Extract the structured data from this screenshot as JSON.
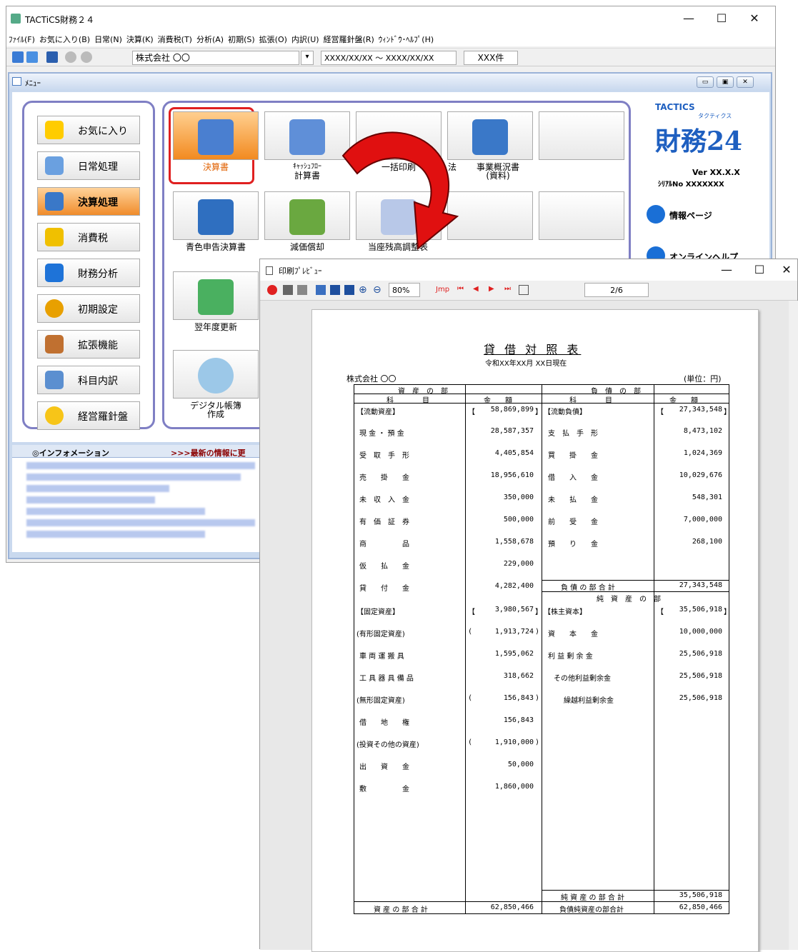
{
  "window": {
    "title": "TACTiCS財務２４",
    "minimize": "—",
    "maximize": "☐",
    "close": "✕"
  },
  "menubar": [
    "ﾌｧｲﾙ(F)",
    "お気に入り(B)",
    "日常(N)",
    "決算(K)",
    "消費税(T)",
    "分析(A)",
    "初期(S)",
    "拡張(O)",
    "内訳(U)",
    "経営羅針盤(R)",
    "ｳｨﾝﾄﾞｳ･ﾍﾙﾌﾟ(H)"
  ],
  "toolbar": {
    "company": "株式会社 〇〇",
    "period": "XXXX/XX/XX ～ XXXX/XX/XX",
    "count": "XXX件",
    "dropdown": "▾"
  },
  "menu_window": {
    "title": "ﾒﾆｭｰ",
    "btns": [
      "▭",
      "▣",
      "✕"
    ]
  },
  "nav": [
    "お気に入り",
    "日常処理",
    "決算処理",
    "消費税",
    "財務分析",
    "初期設定",
    "拡張機能",
    "科目内訳",
    "経営羅針盤"
  ],
  "tiles": {
    "kessansho": "決算書",
    "cashflow": [
      "ｷｬｯｼｭﾌﾛｰ",
      "計算書"
    ],
    "ikkatsu": "一括印刷",
    "jigyo": [
      "事業概況書",
      "(資料)"
    ],
    "aoiro": "青色申告決算書",
    "genka": "減価償却",
    "touza": "当座残高調整表",
    "yokunen": "翌年度更新",
    "digital": [
      "デジタル帳簿",
      "作成"
    ],
    "cut1": "法"
  },
  "brand": {
    "logo": "TACTICS",
    "logo_sub": "タクティクス",
    "name": "財務24",
    "ver": "Ver XX.X.X",
    "serial": "ｼﾘｱﾙNo XXXXXXX",
    "info_page": "情報ページ",
    "online": "オンラインヘルプ"
  },
  "info": {
    "title": "◎インフォメーション",
    "link": ">>>最新の情報に更"
  },
  "preview": {
    "title": "印刷ﾌﾟﾚﾋﾞｭｰ",
    "zoom": "80%",
    "jmp": "Jmp",
    "page": "2/6"
  },
  "bs": {
    "title": "貸 借 対 照 表",
    "date": "令和XX年XX月 XX日現在",
    "company": "株式会社 〇〇",
    "unit": "(単位：円)",
    "asset_head": "資　産　の　部",
    "liab_head": "負　債　の　部",
    "col_item": "科　　　　目",
    "col_amt": "金　　額",
    "current_assets": "【流動資産】",
    "current_assets_amt": "58,869,899",
    "fixed_assets": "【固定資産】",
    "fixed_assets_amt": "3,980,567",
    "current_liab": "【流動負債】",
    "current_liab_amt": "27,343,548",
    "equity_head": "純　資　産　の　部",
    "shareholder": "【株主資本】",
    "shareholder_amt": "35,506,918",
    "assets_rows": [
      [
        "現 金 ・ 預 金",
        "28,587,357"
      ],
      [
        "受　取　手　形",
        "4,405,854"
      ],
      [
        "売　　掛　　金",
        "18,956,610"
      ],
      [
        "未　収　入　金",
        "350,000"
      ],
      [
        "有　価　証　券",
        "500,000"
      ],
      [
        "商　　　　　品",
        "1,558,678"
      ],
      [
        "仮　　払　　金",
        "229,000"
      ],
      [
        "貸　　付　　金",
        "4,282,400"
      ]
    ],
    "fixed_rows": [
      [
        "(有形固定資産)",
        "1,913,724",
        true
      ],
      [
        "車 両 運 搬 具",
        "1,595,062",
        false
      ],
      [
        "工 具 器 具 備 品",
        "318,662",
        false
      ],
      [
        "(無形固定資産)",
        "156,843",
        true
      ],
      [
        "借　　地　　権",
        "156,843",
        false
      ],
      [
        "(投資その他の資産)",
        "1,910,000",
        true
      ],
      [
        "出　　資　　金",
        "50,000",
        false
      ],
      [
        "敷　　　　　金",
        "1,860,000",
        false
      ]
    ],
    "liab_rows": [
      [
        "支　払　手　形",
        "8,473,102"
      ],
      [
        "買　　掛　　金",
        "1,024,369"
      ],
      [
        "借　　入　　金",
        "10,029,676"
      ],
      [
        "未　　払　　金",
        "548,301"
      ],
      [
        "前　　受　　金",
        "7,000,000"
      ],
      [
        "預　　り　　金",
        "268,100"
      ]
    ],
    "liab_total": [
      "負 債 の 部 合 計",
      "27,343,548"
    ],
    "equity_rows": [
      [
        "資　　本　　金",
        "10,000,000"
      ],
      [
        "利 益 剰 余 金",
        "25,506,918"
      ],
      [
        "その他利益剰余金",
        "25,506,918"
      ],
      [
        "繰越利益剰余金",
        "25,506,918"
      ]
    ],
    "net_total": [
      "純 資 産 の 部 合 計",
      "35,506,918"
    ],
    "asset_total": [
      "資 産 の 部 合 計",
      "62,850,466"
    ],
    "grand_total": [
      "負債純資産の部合計",
      "62,850,466"
    ]
  }
}
